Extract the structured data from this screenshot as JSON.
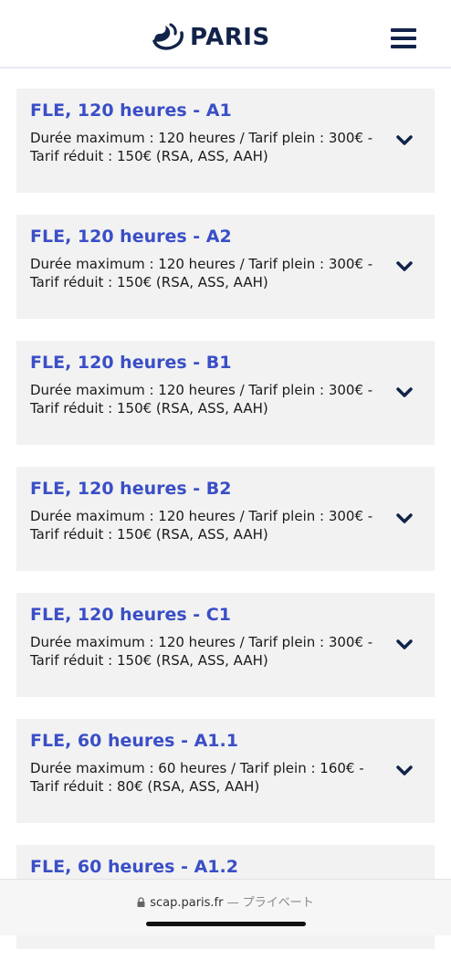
{
  "header": {
    "logo_text": "PARIS",
    "logo_icon": "paris-logo-icon",
    "menu_icon": "hamburger-menu-icon"
  },
  "courses": [
    {
      "title": "FLE, 120 heures - A1",
      "description": "Durée maximum : 120 heures / Tarif plein : 300€ - Tarif réduit : 150€ (RSA, ASS, AAH)"
    },
    {
      "title": "FLE, 120 heures - A2",
      "description": "Durée maximum : 120 heures / Tarif plein : 300€ - Tarif réduit : 150€ (RSA, ASS, AAH)"
    },
    {
      "title": "FLE, 120 heures - B1",
      "description": "Durée maximum : 120 heures / Tarif plein : 300€ - Tarif réduit : 150€ (RSA, ASS, AAH)"
    },
    {
      "title": "FLE, 120 heures - B2",
      "description": "Durée maximum : 120 heures / Tarif plein : 300€ - Tarif réduit : 150€ (RSA, ASS, AAH)"
    },
    {
      "title": "FLE, 120 heures - C1",
      "description": "Durée maximum : 120 heures / Tarif plein : 300€ - Tarif réduit : 150€ (RSA, ASS, AAH)"
    },
    {
      "title": "FLE, 60 heures - A1.1",
      "description": "Durée maximum : 60 heures / Tarif plein : 160€ - Tarif réduit : 80€ (RSA, ASS, AAH)"
    },
    {
      "title": "FLE, 60 heures - A1.2",
      "description": ""
    }
  ],
  "browser": {
    "url": "scap.paris.fr",
    "separator": "—",
    "mode": "プライベート",
    "lock_icon": "lock-icon"
  },
  "colors": {
    "title_blue": "#3a4fc6",
    "navy": "#12234a",
    "card_bg": "#f2f2f2"
  }
}
